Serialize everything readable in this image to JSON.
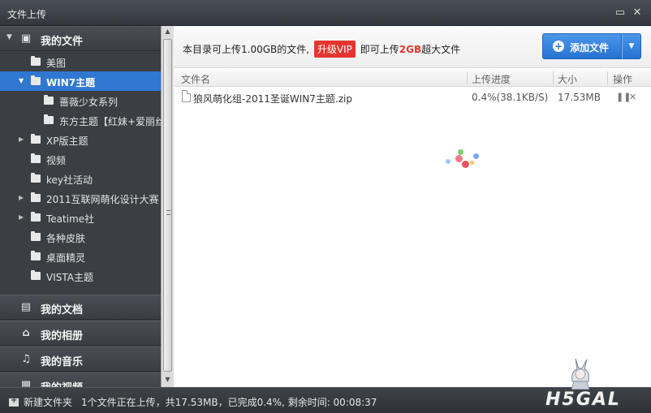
{
  "window": {
    "title": "文件上传",
    "buttons": {
      "restore": "▭",
      "close": "✕"
    }
  },
  "sidebar": {
    "sections": [
      {
        "id": "my-files",
        "label": "我的文件",
        "icon": "briefcase-icon",
        "expanded": true
      },
      {
        "id": "my-docs",
        "label": "我的文档",
        "icon": "document-icon"
      },
      {
        "id": "my-albums",
        "label": "我的相册",
        "icon": "photo-album-icon"
      },
      {
        "id": "my-music",
        "label": "我的音乐",
        "icon": "music-note-icon"
      },
      {
        "id": "my-videos",
        "label": "我的视频",
        "icon": "film-icon"
      }
    ],
    "tree": [
      {
        "label": "美图",
        "level": 1,
        "has_children": false,
        "selected": false
      },
      {
        "label": "WIN7主题",
        "level": 1,
        "has_children": true,
        "expanded": true,
        "selected": true
      },
      {
        "label": "蔷薇少女系列",
        "level": 2,
        "has_children": false,
        "selected": false
      },
      {
        "label": "东方主题【红妹+爱丽丝",
        "level": 2,
        "has_children": false,
        "selected": false
      },
      {
        "label": "XP版主题",
        "level": 1,
        "has_children": true,
        "expanded": false,
        "selected": false
      },
      {
        "label": "视频",
        "level": 1,
        "has_children": false,
        "selected": false
      },
      {
        "label": "key社活动",
        "level": 1,
        "has_children": false,
        "selected": false
      },
      {
        "label": "2011互联网萌化设计大赛",
        "level": 1,
        "has_children": true,
        "expanded": false,
        "selected": false
      },
      {
        "label": "Teatime社",
        "level": 1,
        "has_children": true,
        "expanded": false,
        "selected": false
      },
      {
        "label": "各种皮肤",
        "level": 1,
        "has_children": false,
        "selected": false
      },
      {
        "label": "桌面精灵",
        "level": 1,
        "has_children": false,
        "selected": false
      },
      {
        "label": "VISTA主题",
        "level": 1,
        "has_children": false,
        "selected": false
      }
    ]
  },
  "infobar": {
    "text_before": "本目录可上传1.00GB的文件,",
    "vip_badge": "升级VIP",
    "text_middle": "即可上传",
    "highlight": "2GB",
    "text_after": "超大文件"
  },
  "add_button": {
    "label": "添加文件",
    "dropdown_icon": "▼"
  },
  "columns": {
    "name": "文件名",
    "progress": "上传进度",
    "size": "大小",
    "action": "操作"
  },
  "files": [
    {
      "name": "狼风萌化组-2011圣诞WIN7主题.zip",
      "progress": "0.4%(38.1KB/S)",
      "size": "17.53MB",
      "progress_fraction": 0.004
    }
  ],
  "statusbar": {
    "new_folder": "新建文件夹",
    "status": "1个文件正在上传，共17.53MB，已完成0.4%, 剩余时间: 00:08:37",
    "watermark": "H5GAL"
  },
  "colors": {
    "accent": "#2f77d0",
    "vip": "#e2362f",
    "sidebar_bg": "#3b3f44"
  }
}
